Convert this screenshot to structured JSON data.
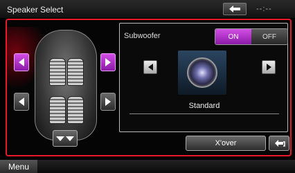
{
  "header": {
    "title": "Speaker Select",
    "status": "--:--"
  },
  "subwoofer": {
    "label": "Subwoofer",
    "on_label": "ON",
    "off_label": "OFF",
    "selected": "ON"
  },
  "speaker": {
    "type": "Standard"
  },
  "buttons": {
    "xover": "X'over"
  },
  "footer": {
    "menu": "Menu"
  },
  "colors": {
    "accent": "#c034d8",
    "frame": "#e8172a"
  }
}
